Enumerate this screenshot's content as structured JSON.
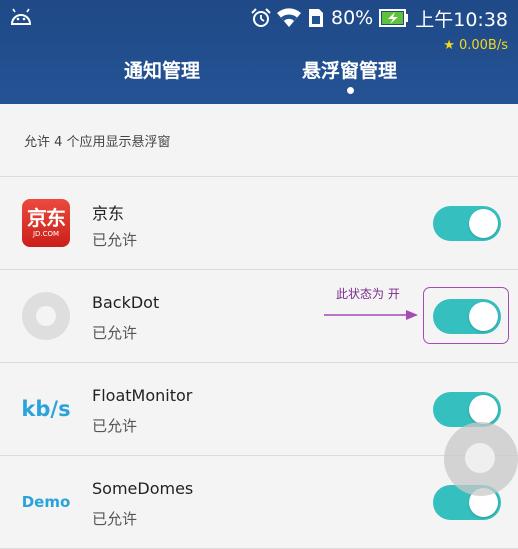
{
  "status_bar": {
    "battery": "80%",
    "time": "上午10:38",
    "net_speed": "★ 0.00B/s"
  },
  "tabs": [
    {
      "label": "通知管理",
      "selected": false
    },
    {
      "label": "悬浮窗管理",
      "selected": true
    }
  ],
  "summary": "允许 4 个应用显示悬浮窗",
  "apps": [
    {
      "name": "京东",
      "status": "已允许",
      "icon": "jd-logo-icon",
      "icon_text": "京东",
      "icon_subtext": "JD.COM",
      "enabled": true
    },
    {
      "name": "BackDot",
      "status": "已允许",
      "icon": "backdot-icon",
      "enabled": true
    },
    {
      "name": "FloatMonitor",
      "status": "已允许",
      "icon": "kbs-icon",
      "icon_text": "kb/s",
      "enabled": true
    },
    {
      "name": "SomeDomes",
      "status": "已允许",
      "icon": "demo-icon",
      "icon_text": "Demo",
      "enabled": true
    }
  ],
  "annotation": "此状态为 开",
  "colors": {
    "header": "#245394",
    "toggle_on": "#35bfbf",
    "annotation": "#a64ab5",
    "speed": "#f2d81c"
  }
}
